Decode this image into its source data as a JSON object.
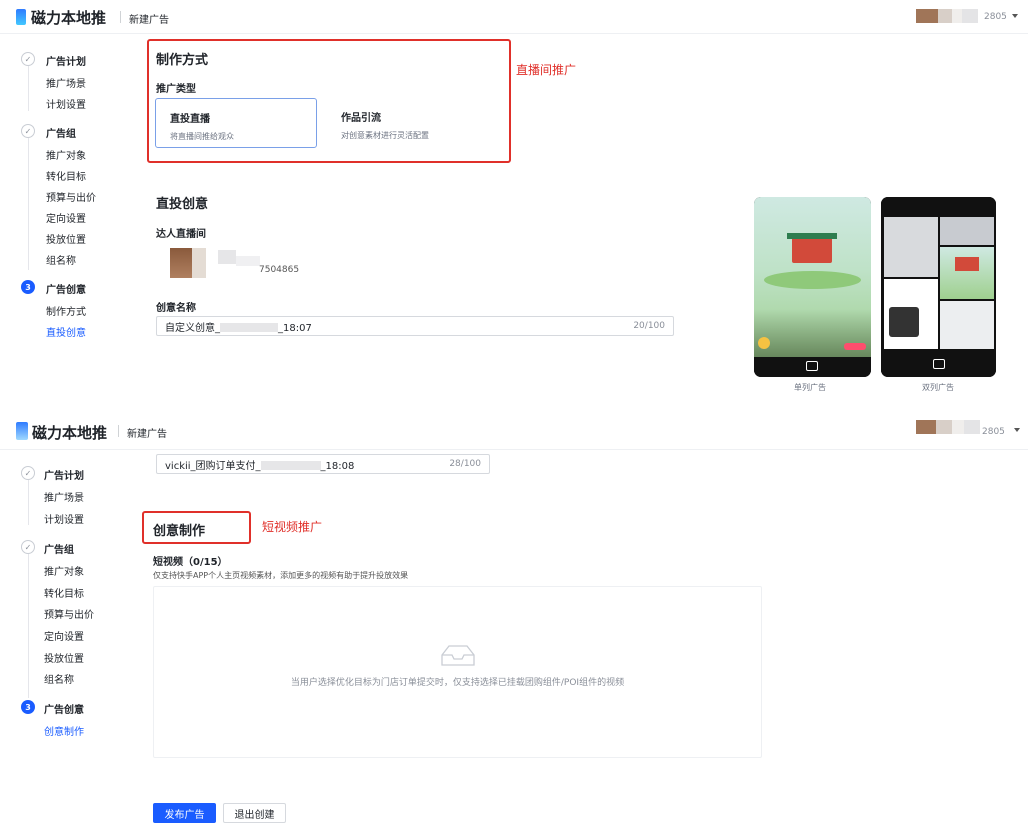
{
  "top": {
    "brand": "磁力本地推",
    "page_title": "新建广告",
    "account_suffix": "2805",
    "steps": [
      {
        "num": "✓",
        "title": "广告计划",
        "subs": [
          "推广场景",
          "计划设置"
        ]
      },
      {
        "num": "✓",
        "title": "广告组",
        "subs": [
          "推广对象",
          "转化目标",
          "预算与出价",
          "定向设置",
          "投放位置",
          "组名称"
        ]
      },
      {
        "num": "3",
        "title": "广告创意",
        "subs": [
          "制作方式",
          "直投创意"
        ]
      }
    ],
    "production": {
      "title": "制作方式",
      "type_label": "推广类型",
      "options": [
        {
          "title": "直投直播",
          "desc": "将直播间推给观众"
        },
        {
          "title": "作品引流",
          "desc": "对创意素材进行灵活配置"
        }
      ],
      "annotation": "直播间推广"
    },
    "direct_creative": {
      "title": "直投创意",
      "live_room_label": "达人直播间",
      "live_room_id": "7504865",
      "creative_name_label": "创意名称",
      "creative_name_prefix": "自定义创意_",
      "creative_name_suffix": "_18:07",
      "creative_name_count": "20/100"
    },
    "previews": [
      {
        "caption": "单列广告"
      },
      {
        "caption": "双列广告"
      }
    ]
  },
  "bottom": {
    "brand": "磁力本地推",
    "page_title": "新建广告",
    "account_suffix": "2805",
    "steps": [
      {
        "num": "✓",
        "title": "广告计划",
        "subs": [
          "推广场景",
          "计划设置"
        ]
      },
      {
        "num": "✓",
        "title": "广告组",
        "subs": [
          "推广对象",
          "转化目标",
          "预算与出价",
          "定向设置",
          "投放位置",
          "组名称"
        ]
      },
      {
        "num": "3",
        "title": "广告创意",
        "subs": [
          "创意制作"
        ]
      }
    ],
    "name_input": {
      "prefix": "vickii_团购订单支付_",
      "suffix": "_18:08",
      "count": "28/100"
    },
    "creative": {
      "title": "创意制作",
      "annotation": "短视频推广",
      "short_video_label": "短视频（0/15）",
      "short_video_desc": "仅支持快手APP个人主页视频素材，添加更多的视频有助于提升投放效果",
      "empty_hint": "当用户选择优化目标为门店订单提交时，仅支持选择已挂载团购组件/POI组件的视频"
    },
    "actions": {
      "publish": "发布广告",
      "exit": "退出创建"
    }
  },
  "colors": {
    "primary": "#1a5cff",
    "annotation_red": "#e0302a"
  }
}
